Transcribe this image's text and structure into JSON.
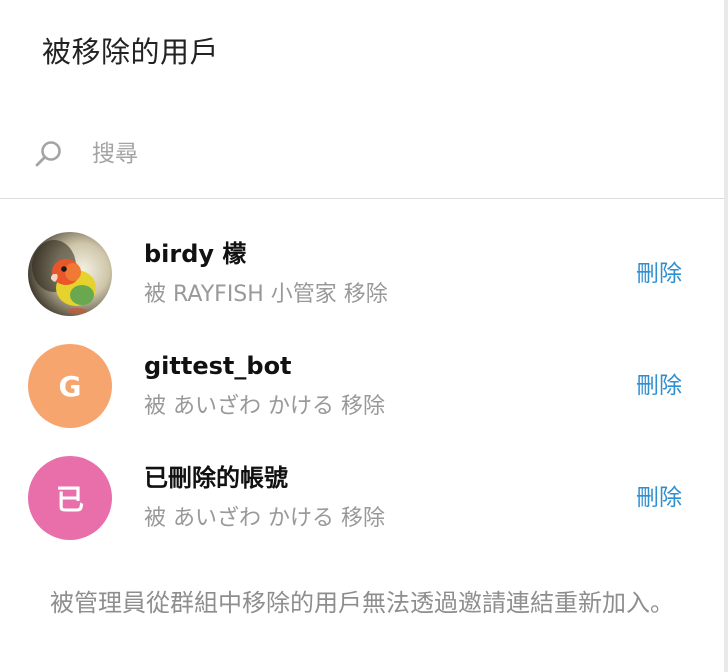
{
  "header": {
    "title": "被移除的用戶"
  },
  "search": {
    "placeholder": "搜尋",
    "icon": "search-icon"
  },
  "colors": {
    "link": "#2f8fcf",
    "title": "#222222",
    "secondary": "#999999",
    "avatar_orange": "#f6a56f",
    "avatar_pink": "#e96fab"
  },
  "users": [
    {
      "name": "birdy 檬",
      "subtitle": "被 RAYFISH 小管家 移除",
      "action": "刪除",
      "avatar": {
        "type": "photo",
        "description": "bird-photo"
      }
    },
    {
      "name": "gittest_bot",
      "subtitle": "被 あいざわ かける 移除",
      "action": "刪除",
      "avatar": {
        "type": "letter",
        "letter": "G",
        "color": "#f6a56f"
      }
    },
    {
      "name": "已刪除的帳號",
      "subtitle": "被 あいざわ かける 移除",
      "action": "刪除",
      "avatar": {
        "type": "letter",
        "letter": "已",
        "color": "#e96fab"
      }
    }
  ],
  "footer": {
    "note": "被管理員從群組中移除的用戶無法透過邀請連結重新加入。"
  }
}
